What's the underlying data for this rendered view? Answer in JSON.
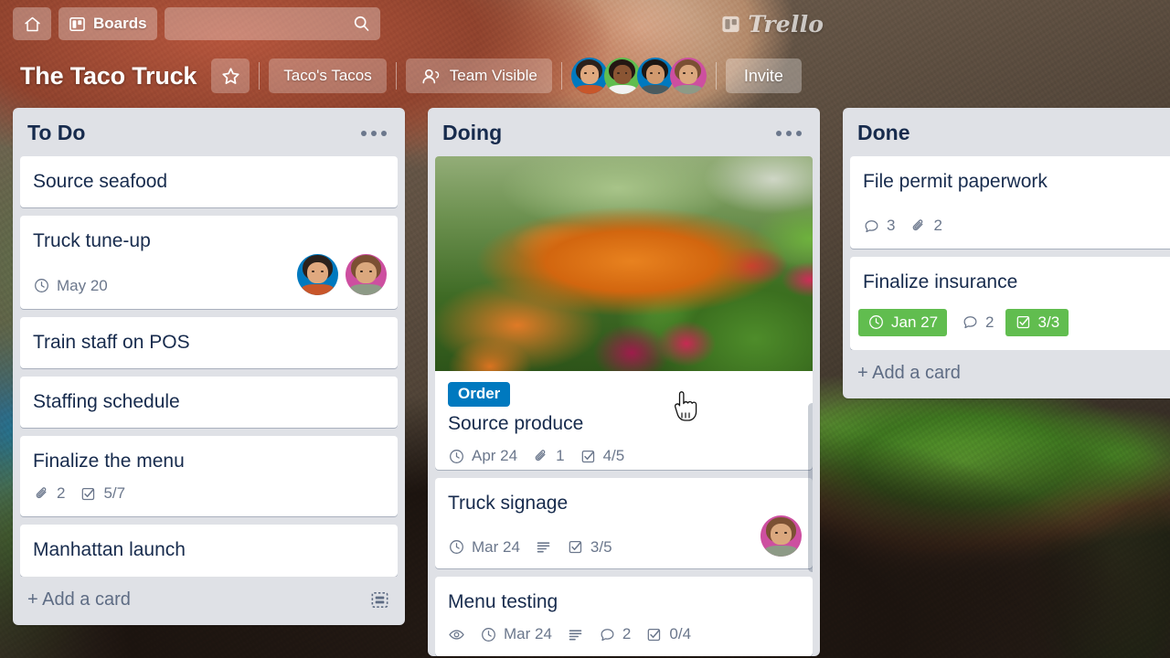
{
  "topbar": {
    "home_label": "",
    "boards_label": "Boards",
    "search_placeholder": "",
    "search_value": "",
    "logo_text": "Trello"
  },
  "board_header": {
    "title": "The Taco Truck",
    "star_label": "",
    "team_name": "Taco's Tacos",
    "visibility": "Team Visible",
    "invite_label": "Invite",
    "members": [
      {
        "name": "member-1",
        "ring": "#0079bf",
        "hair": "#2b211c",
        "skin": "#e0a97f",
        "shirt": "#c8562a"
      },
      {
        "name": "member-2",
        "ring": "#61bd4f",
        "hair": "#241713",
        "skin": "#8a5533",
        "shirt": "#f2f2f2"
      },
      {
        "name": "member-3",
        "ring": "#0079bf",
        "hair": "#1d1713",
        "skin": "#d19a6e",
        "shirt": "#4a5a5e"
      },
      {
        "name": "member-4",
        "ring": "#cd4fa0",
        "hair": "#7b5033",
        "skin": "#dba87e",
        "shirt": "#8d9a86"
      }
    ]
  },
  "lists": [
    {
      "title": "To Do",
      "add_card_label": "+ Add a card",
      "has_template_icon": true,
      "cards": [
        {
          "title": "Source seafood",
          "badges": [],
          "members": []
        },
        {
          "title": "Truck tune-up",
          "badges": [
            {
              "type": "due",
              "icon": "clock-icon",
              "text": "May 20",
              "green": false
            }
          ],
          "members": [
            {
              "name": "member-1",
              "ring": "#0079bf",
              "hair": "#2b211c",
              "skin": "#e0a97f",
              "shirt": "#c8562a"
            },
            {
              "name": "member-4",
              "ring": "#cd4fa0",
              "hair": "#7b5033",
              "skin": "#dba87e",
              "shirt": "#8d9a86"
            }
          ]
        },
        {
          "title": "Train staff on POS",
          "badges": [],
          "members": []
        },
        {
          "title": "Staffing schedule",
          "badges": [],
          "members": []
        },
        {
          "title": "Finalize the menu",
          "badges": [
            {
              "type": "attachment",
              "icon": "paperclip-icon",
              "text": "2",
              "green": false
            },
            {
              "type": "checklist",
              "icon": "checklist-icon",
              "text": "5/7",
              "green": false
            }
          ],
          "members": []
        },
        {
          "title": "Manhattan launch",
          "badges": [],
          "members": []
        }
      ]
    },
    {
      "title": "Doing",
      "add_card_label": "",
      "has_template_icon": false,
      "has_scrollbar": true,
      "cards": [
        {
          "title": "Source produce",
          "cover": "farmers-market-vegetables",
          "label": {
            "text": "Order",
            "color": "#0079bf"
          },
          "badges": [
            {
              "type": "due",
              "icon": "clock-icon",
              "text": "Apr 24",
              "green": false
            },
            {
              "type": "attachment",
              "icon": "paperclip-icon",
              "text": "1",
              "green": false
            },
            {
              "type": "checklist",
              "icon": "checklist-icon",
              "text": "4/5",
              "green": false
            }
          ],
          "members": []
        },
        {
          "title": "Truck signage",
          "badges": [
            {
              "type": "due",
              "icon": "clock-icon",
              "text": "Mar 24",
              "green": false
            },
            {
              "type": "description",
              "icon": "description-icon",
              "text": "",
              "green": false
            },
            {
              "type": "checklist",
              "icon": "checklist-icon",
              "text": "3/5",
              "green": false
            }
          ],
          "members": [
            {
              "name": "member-4",
              "ring": "#cd4fa0",
              "hair": "#7b5033",
              "skin": "#dba87e",
              "shirt": "#8d9a86"
            }
          ]
        },
        {
          "title": "Menu testing",
          "badges": [
            {
              "type": "watch",
              "icon": "eye-icon",
              "text": "",
              "green": false
            },
            {
              "type": "due",
              "icon": "clock-icon",
              "text": "Mar 24",
              "green": false
            },
            {
              "type": "description",
              "icon": "description-icon",
              "text": "",
              "green": false
            },
            {
              "type": "comment",
              "icon": "comment-icon",
              "text": "2",
              "green": false
            },
            {
              "type": "checklist",
              "icon": "checklist-icon",
              "text": "0/4",
              "green": false
            }
          ],
          "members": []
        }
      ]
    },
    {
      "title": "Done",
      "add_card_label": "+ Add a card",
      "has_template_icon": false,
      "cards": [
        {
          "title": "File permit paperwork",
          "badges": [
            {
              "type": "comment",
              "icon": "comment-icon",
              "text": "3",
              "green": false
            },
            {
              "type": "attachment",
              "icon": "paperclip-icon",
              "text": "2",
              "green": false
            }
          ],
          "members": [
            {
              "name": "member-1",
              "ring": "#0079bf",
              "hair": "#2b211c",
              "skin": "#e0a97f",
              "shirt": "#c8562a"
            }
          ]
        },
        {
          "title": "Finalize insurance",
          "badges": [
            {
              "type": "due",
              "icon": "clock-icon",
              "text": "Jan 27",
              "green": true
            },
            {
              "type": "comment",
              "icon": "comment-icon",
              "text": "2",
              "green": false
            },
            {
              "type": "checklist",
              "icon": "checklist-icon",
              "text": "3/3",
              "green": true
            }
          ],
          "members": [
            {
              "name": "member-3",
              "ring": "#0079bf",
              "hair": "#1d1713",
              "skin": "#d19a6e",
              "shirt": "#4a5a5e"
            }
          ]
        }
      ]
    }
  ],
  "colors": {
    "list_bg": "#dfe1e6",
    "card_bg": "#ffffff",
    "title_text": "#172b4d",
    "muted_text": "#6b778c",
    "label_blue": "#0079bf",
    "badge_green": "#61bd4f"
  }
}
